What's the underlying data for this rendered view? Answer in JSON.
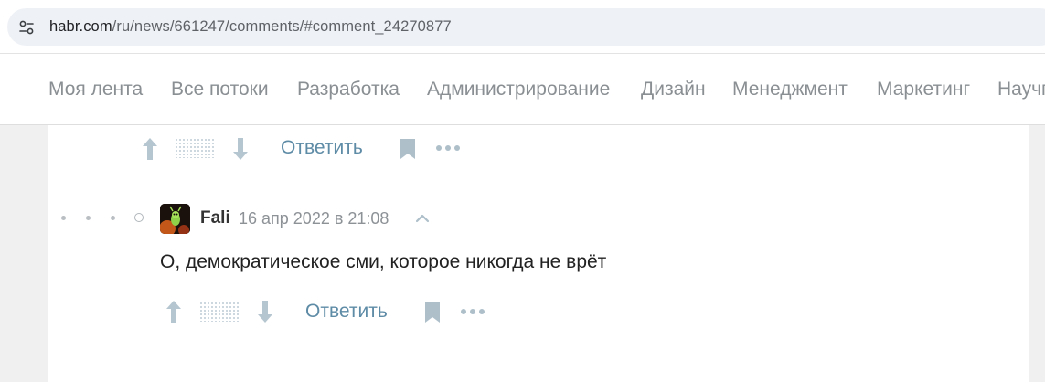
{
  "browser": {
    "url_host": "habr.com",
    "url_path": "/ru/news/661247/comments/#comment_24270877"
  },
  "nav": {
    "items": [
      "Моя лента",
      "Все потоки",
      "Разработка",
      "Администрирование",
      "Дизайн",
      "Менеджмент",
      "Маркетинг",
      "Научпоп"
    ]
  },
  "comments": [
    {
      "reply_label": "Ответить"
    },
    {
      "author": "Fali",
      "timestamp": "16 апр 2022 в 21:08",
      "text": "О, демократическое сми, которое никогда не врёт",
      "reply_label": "Ответить"
    }
  ],
  "colors": {
    "accent_link": "#5e8ba6",
    "icon_gray": "#aebfca"
  }
}
